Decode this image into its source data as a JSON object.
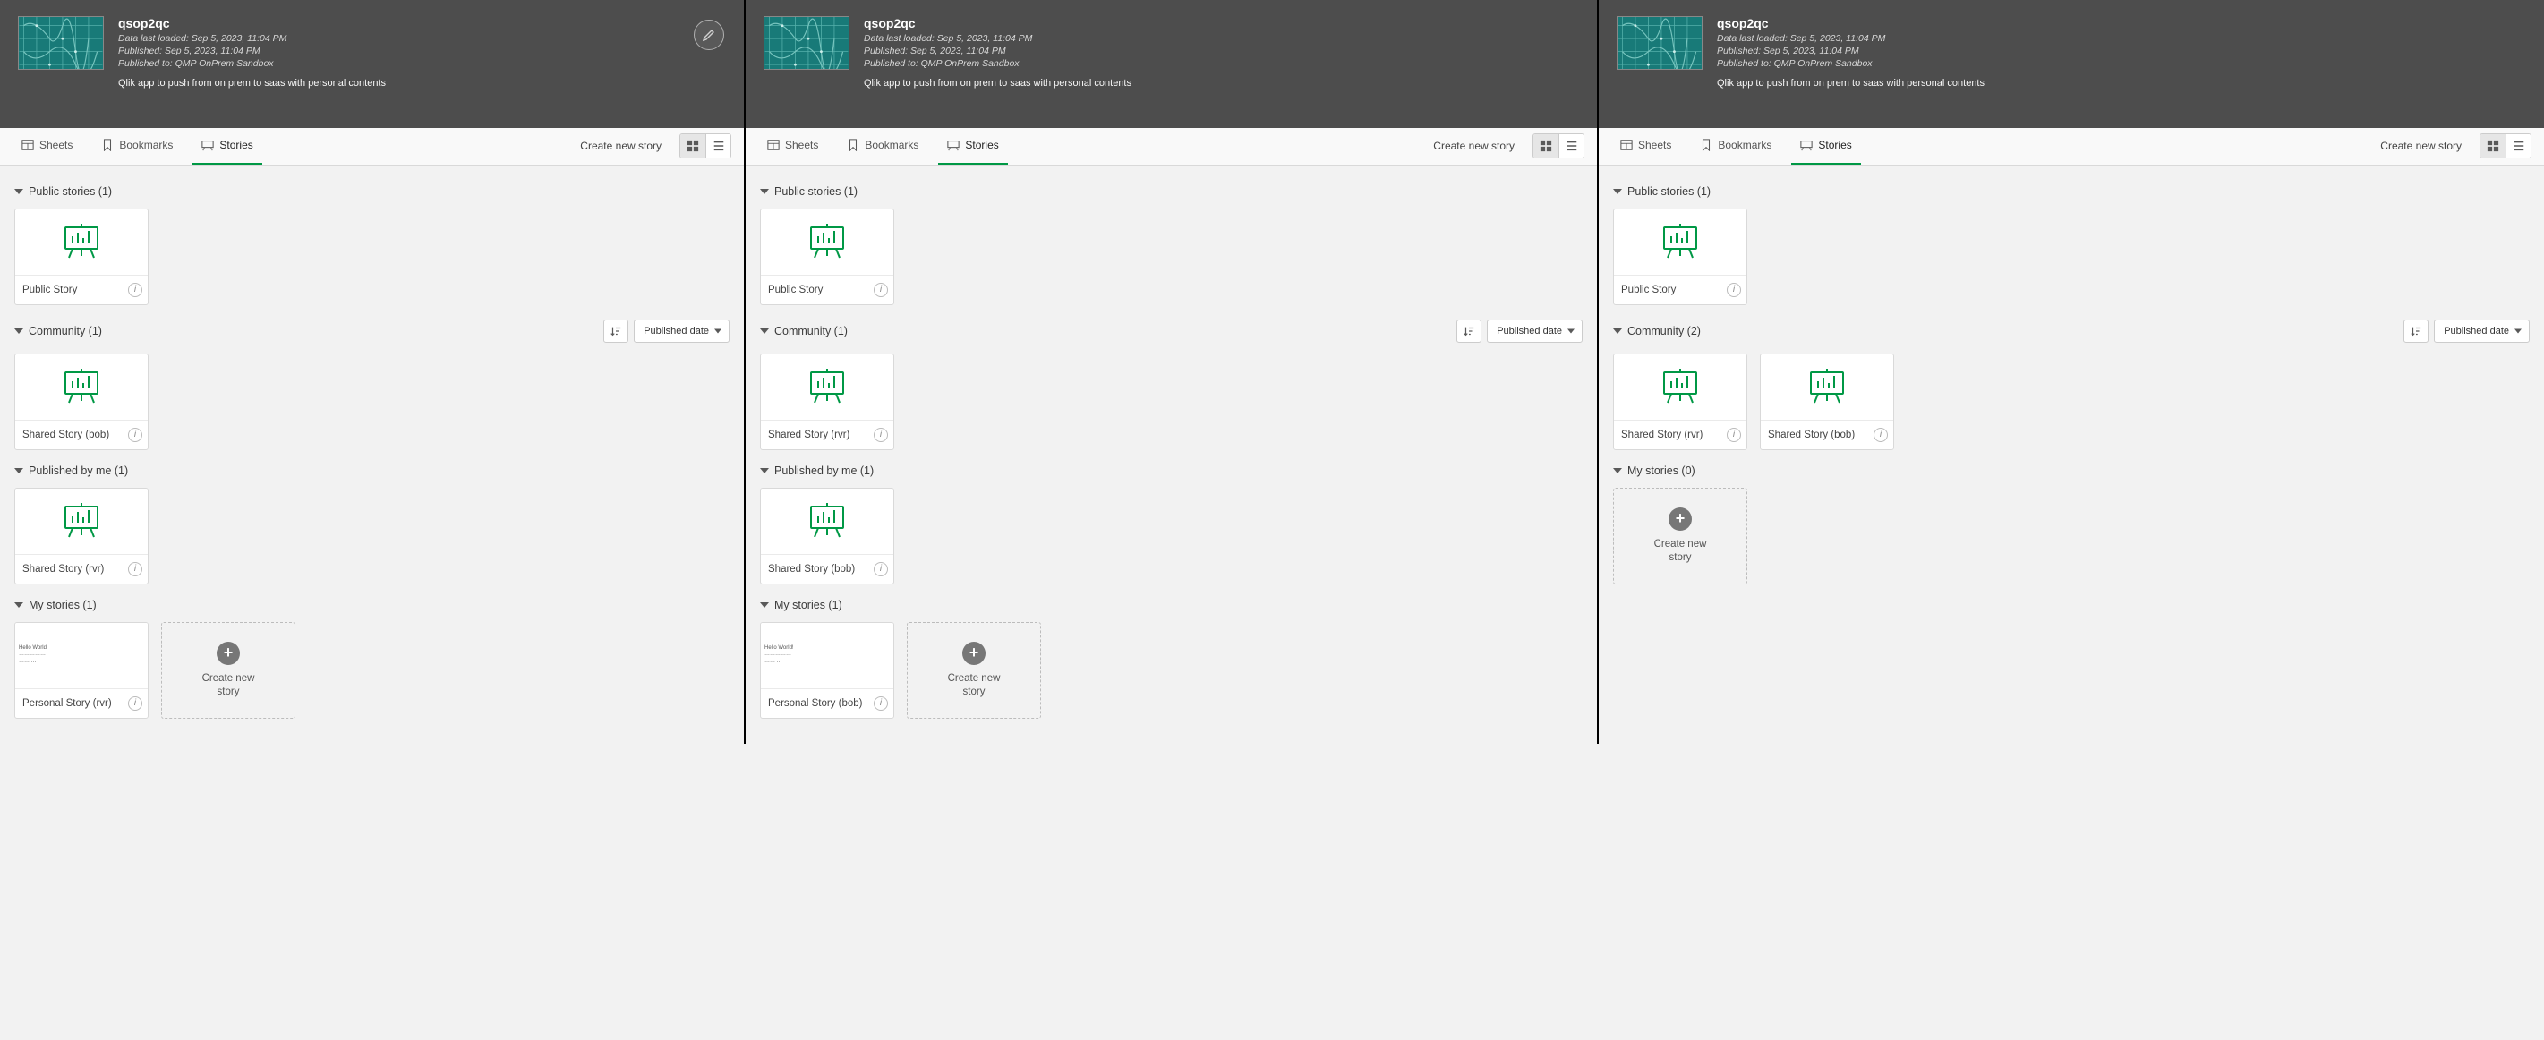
{
  "header": {
    "app_title": "qsop2qc",
    "meta_loaded": "Data last loaded: Sep 5, 2023, 11:04 PM",
    "meta_published": "Published: Sep 5, 2023, 11:04 PM",
    "meta_published_to": "Published to: QMP OnPrem Sandbox",
    "description": "Qlik app to push from on prem to saas with personal contents"
  },
  "tabs": {
    "sheets": "Sheets",
    "bookmarks": "Bookmarks",
    "stories": "Stories",
    "create_story": "Create new story"
  },
  "sort": {
    "label": "Published date"
  },
  "create_card": "Create new story",
  "panels": [
    {
      "show_edit": true,
      "sections": [
        {
          "title": "Public stories (1)",
          "controls": false,
          "cards": [
            {
              "label": "Public Story",
              "thumb": "easel"
            }
          ]
        },
        {
          "title": "Community (1)",
          "controls": true,
          "cards": [
            {
              "label": "Shared Story (bob)",
              "thumb": "easel"
            }
          ]
        },
        {
          "title": "Published by me (1)",
          "controls": false,
          "cards": [
            {
              "label": "Shared Story (rvr)",
              "thumb": "easel"
            }
          ]
        },
        {
          "title": "My stories (1)",
          "controls": false,
          "cards": [
            {
              "label": "Personal Story (rvr)",
              "thumb": "personal"
            }
          ],
          "create": true
        }
      ]
    },
    {
      "show_edit": false,
      "sections": [
        {
          "title": "Public stories (1)",
          "controls": false,
          "cards": [
            {
              "label": "Public Story",
              "thumb": "easel"
            }
          ]
        },
        {
          "title": "Community (1)",
          "controls": true,
          "cards": [
            {
              "label": "Shared Story (rvr)",
              "thumb": "easel"
            }
          ]
        },
        {
          "title": "Published by me (1)",
          "controls": false,
          "cards": [
            {
              "label": "Shared Story (bob)",
              "thumb": "easel"
            }
          ]
        },
        {
          "title": "My stories (1)",
          "controls": false,
          "cards": [
            {
              "label": "Personal Story (bob)",
              "thumb": "personal"
            }
          ],
          "create": true
        }
      ]
    },
    {
      "show_edit": false,
      "sections": [
        {
          "title": "Public stories (1)",
          "controls": false,
          "cards": [
            {
              "label": "Public Story",
              "thumb": "easel"
            }
          ]
        },
        {
          "title": "Community (2)",
          "controls": true,
          "cards": [
            {
              "label": "Shared Story (rvr)",
              "thumb": "easel"
            },
            {
              "label": "Shared Story (bob)",
              "thumb": "easel"
            }
          ]
        },
        {
          "title": "My stories (0)",
          "controls": false,
          "cards": [],
          "create": true
        }
      ]
    }
  ]
}
